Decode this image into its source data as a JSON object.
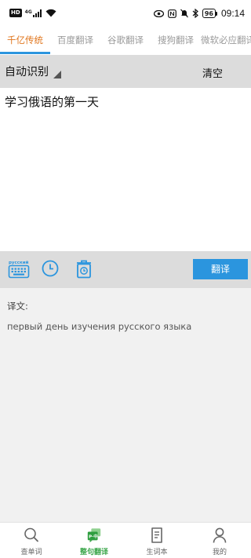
{
  "status_bar": {
    "hd": "HD",
    "signal": "4G",
    "battery": "96",
    "time": "09:14"
  },
  "tabs": [
    {
      "label": "千亿传统",
      "active": true
    },
    {
      "label": "百度翻译",
      "active": false
    },
    {
      "label": "谷歌翻译",
      "active": false
    },
    {
      "label": "搜狗翻译",
      "active": false
    },
    {
      "label": "微软必应翻译",
      "active": false
    }
  ],
  "lang_bar": {
    "source_language": "自动识别",
    "clear_label": "清空"
  },
  "input": {
    "text": "学习俄语的第一天"
  },
  "toolbar": {
    "keyboard_icon_label": "русский",
    "translate_label": "翻译"
  },
  "result": {
    "label": "译文:",
    "text": "первый день изучения русского языка"
  },
  "bottom_nav": [
    {
      "label": "查单词",
      "icon": "search-icon",
      "active": false
    },
    {
      "label": "整句翻译",
      "icon": "translate-chat-icon",
      "active": true
    },
    {
      "label": "生词本",
      "icon": "notebook-icon",
      "active": false
    },
    {
      "label": "我的",
      "icon": "person-icon",
      "active": false
    }
  ],
  "colors": {
    "accent_blue": "#2b95de",
    "active_tab": "#e0751c",
    "active_nav": "#3aa64a"
  }
}
